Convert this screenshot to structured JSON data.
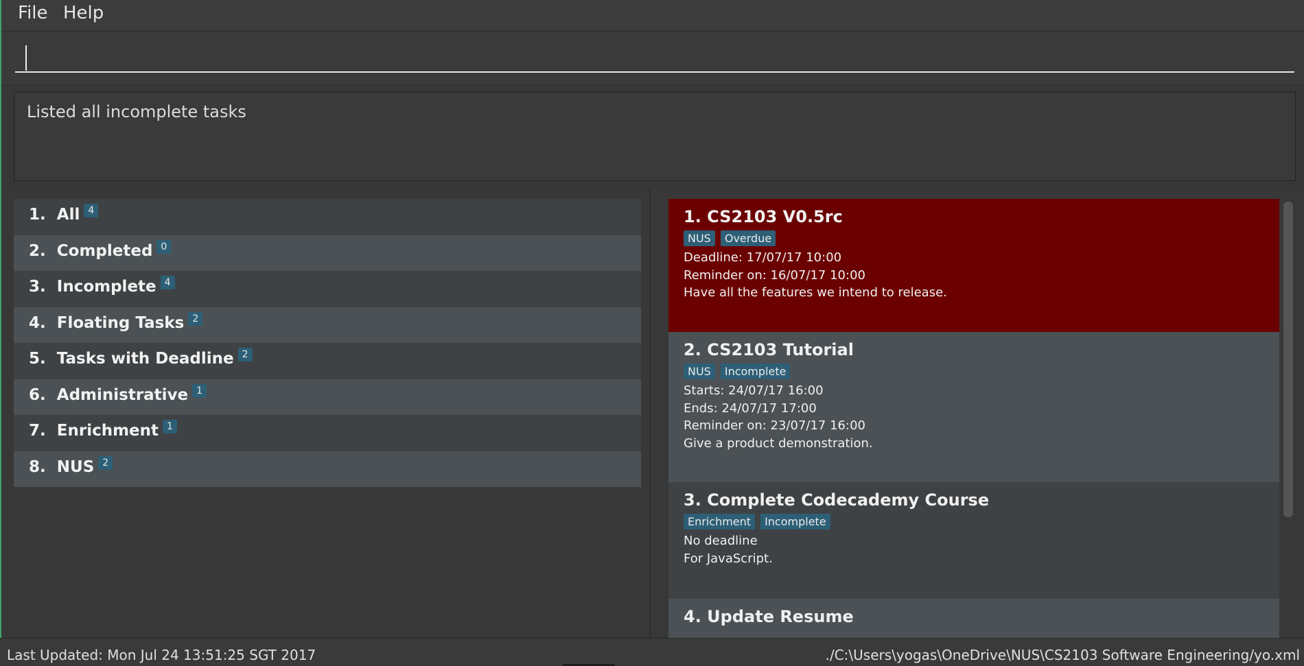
{
  "menu": {
    "file": "File",
    "help": "Help"
  },
  "command": {
    "value": "",
    "placeholder": ""
  },
  "result": {
    "message": "Listed all incomplete tasks"
  },
  "categories": [
    {
      "index": "1.",
      "label": "All",
      "count": "4"
    },
    {
      "index": "2.",
      "label": "Completed",
      "count": "0"
    },
    {
      "index": "3.",
      "label": "Incomplete",
      "count": "4"
    },
    {
      "index": "4.",
      "label": "Floating Tasks",
      "count": "2"
    },
    {
      "index": "5.",
      "label": "Tasks with Deadline",
      "count": "2"
    },
    {
      "index": "6.",
      "label": "Administrative",
      "count": "1"
    },
    {
      "index": "7.",
      "label": "Enrichment",
      "count": "1"
    },
    {
      "index": "8.",
      "label": "NUS",
      "count": "2"
    }
  ],
  "tasks": [
    {
      "title": "1.  CS2103 V0.5rc",
      "tags": [
        "NUS",
        "Overdue"
      ],
      "lines": [
        "Deadline: 17/07/17 10:00",
        "Reminder on: 16/07/17 10:00",
        "Have all the features we intend to release."
      ]
    },
    {
      "title": "2.  CS2103 Tutorial",
      "tags": [
        "NUS",
        "Incomplete"
      ],
      "lines": [
        "Starts: 24/07/17 16:00",
        "Ends: 24/07/17 17:00",
        "Reminder on: 23/07/17 16:00",
        "Give a product demonstration."
      ]
    },
    {
      "title": "3.  Complete Codecademy Course",
      "tags": [
        "Enrichment",
        "Incomplete"
      ],
      "lines": [
        "No deadline",
        "For JavaScript."
      ]
    },
    {
      "title": "4.  Update Resume",
      "tags": [],
      "lines": []
    }
  ],
  "status": {
    "last_updated": "Last Updated: Mon Jul 24 13:51:25 SGT 2017",
    "file_path": "./C:\\Users\\yogas\\OneDrive\\NUS\\CS2103 Software Engineering/yo.xml"
  },
  "colors": {
    "overdue": "#6b0000",
    "tag": "#2d5f76",
    "accent_edge": "#3fa36a"
  }
}
